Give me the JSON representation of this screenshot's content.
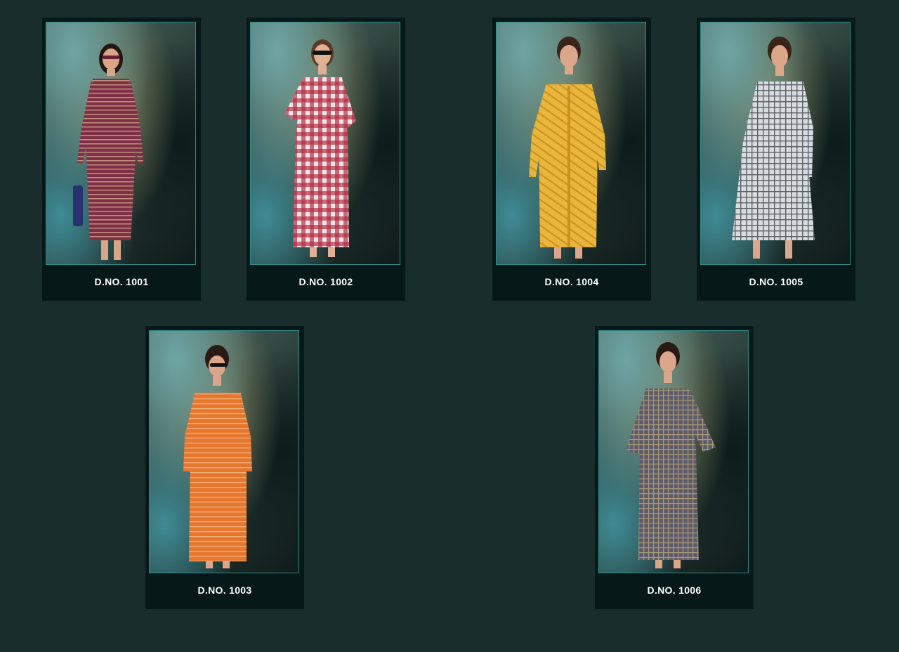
{
  "products": [
    {
      "design_no": "D.NO. 1001",
      "garment_color": "#7e3146",
      "stripe_color": "#c49080"
    },
    {
      "design_no": "D.NO. 1002",
      "garment_color": "#f0e6ea",
      "stripe_color": "#b3263e"
    },
    {
      "design_no": "D.NO. 1004",
      "garment_color": "#e9b53a",
      "stripe_color": "#c99024"
    },
    {
      "design_no": "D.NO. 1005",
      "garment_color": "#d9dcdf",
      "stripe_color": "#5b6167"
    },
    {
      "design_no": "D.NO. 1003",
      "garment_color": "#e6772f",
      "stripe_color": "#f4b07a"
    },
    {
      "design_no": "D.NO. 1006",
      "garment_color": "#5f5c6a",
      "stripe_color": "#a99977"
    }
  ],
  "colors": {
    "page_background": "#1a2d2d",
    "card_background": "#071818",
    "frame_border": "#2f8a86",
    "caption_text": "#ffffff"
  }
}
